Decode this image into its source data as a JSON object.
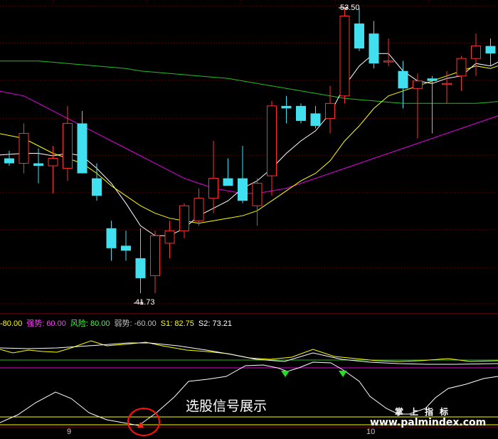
{
  "chart": {
    "high_marker": "53.50",
    "low_marker": "41.73",
    "legend": [
      {
        "text": "-80.00",
        "color": "#ffff00"
      },
      {
        "text": "强势: 60.00",
        "color": "#ff40ff"
      },
      {
        "text": "风险: 80.00",
        "color": "#40ff40"
      },
      {
        "text": "弱势: -60.00",
        "color": "#c0c0c0"
      },
      {
        "text": "S1: 82.75",
        "color": "#ffff00"
      },
      {
        "text": "S2: 73.21",
        "color": "#ffffff"
      }
    ],
    "signal_caption": "选股信号展示",
    "watermark_zh": "掌上指标",
    "watermark_url": "www.palmindex.com",
    "date_labels": [
      "9",
      "10"
    ]
  },
  "colors": {
    "background": "#000000",
    "up_candle": "#ff3030",
    "down_candle": "#40e0f0",
    "ma_short": "#ffffff",
    "ma_mid": "#ffff00",
    "ma_long": "#e000e0",
    "ma_longest": "#20c020"
  },
  "chart_data": {
    "type": "candlestick",
    "ylim": [
      41.73,
      53.5
    ],
    "candles": [
      {
        "open": 47.5,
        "high": 47.8,
        "low": 47.2,
        "close": 47.3
      },
      {
        "open": 47.3,
        "high": 48.9,
        "low": 46.9,
        "close": 48.5
      },
      {
        "open": 47.3,
        "high": 47.9,
        "low": 46.5,
        "close": 47.2
      },
      {
        "open": 47.2,
        "high": 48.0,
        "low": 46.1,
        "close": 47.5
      },
      {
        "open": 47.1,
        "high": 49.6,
        "low": 46.6,
        "close": 48.9
      },
      {
        "open": 48.9,
        "high": 49.4,
        "low": 47.0,
        "close": 46.9
      },
      {
        "open": 46.7,
        "high": 47.3,
        "low": 45.8,
        "close": 46.0
      },
      {
        "open": 44.7,
        "high": 45.0,
        "low": 43.4,
        "close": 43.9
      },
      {
        "open": 44.0,
        "high": 44.6,
        "low": 43.4,
        "close": 43.8
      },
      {
        "open": 43.5,
        "high": 44.7,
        "low": 42.1,
        "close": 42.7
      },
      {
        "open": 42.8,
        "high": 44.6,
        "low": 42.1,
        "close": 44.4
      },
      {
        "open": 44.1,
        "high": 45.0,
        "low": 43.5,
        "close": 44.6
      },
      {
        "open": 44.6,
        "high": 45.7,
        "low": 44.3,
        "close": 45.6
      },
      {
        "open": 45.0,
        "high": 46.3,
        "low": 44.8,
        "close": 45.9
      },
      {
        "open": 45.9,
        "high": 48.2,
        "low": 45.3,
        "close": 46.7
      },
      {
        "open": 46.7,
        "high": 47.5,
        "low": 46.4,
        "close": 46.4
      },
      {
        "open": 46.7,
        "high": 48.0,
        "low": 45.7,
        "close": 45.8
      },
      {
        "open": 45.6,
        "high": 46.7,
        "low": 44.8,
        "close": 46.5
      },
      {
        "open": 46.8,
        "high": 49.8,
        "low": 46.0,
        "close": 49.6
      },
      {
        "open": 49.6,
        "high": 50.0,
        "low": 48.9,
        "close": 49.5
      },
      {
        "open": 49.6,
        "high": 49.7,
        "low": 48.9,
        "close": 49.0
      },
      {
        "open": 49.3,
        "high": 49.6,
        "low": 48.7,
        "close": 48.8
      },
      {
        "open": 49.1,
        "high": 50.4,
        "low": 48.5,
        "close": 49.7
      },
      {
        "open": 50.0,
        "high": 53.5,
        "low": 49.7,
        "close": 53.2
      },
      {
        "open": 52.9,
        "high": 53.5,
        "low": 51.8,
        "close": 51.9
      },
      {
        "open": 52.5,
        "high": 53.0,
        "low": 51.1,
        "close": 51.3
      },
      {
        "open": 51.4,
        "high": 52.3,
        "low": 51.2,
        "close": 51.4
      },
      {
        "open": 51.0,
        "high": 51.4,
        "low": 49.5,
        "close": 50.3
      },
      {
        "open": 50.3,
        "high": 50.9,
        "low": 48.3,
        "close": 50.6
      },
      {
        "open": 50.7,
        "high": 50.8,
        "low": 48.5,
        "close": 50.6
      },
      {
        "open": 50.5,
        "high": 51.0,
        "low": 49.7,
        "close": 50.5
      },
      {
        "open": 50.8,
        "high": 51.6,
        "low": 50.2,
        "close": 51.5
      },
      {
        "open": 51.5,
        "high": 52.5,
        "low": 50.8,
        "close": 52.0
      },
      {
        "open": 52.0,
        "high": 52.3,
        "low": 51.2,
        "close": 51.7
      },
      {
        "open": 51.6,
        "high": 51.8,
        "low": 50.6,
        "close": 51.6
      },
      {
        "open": 51.2,
        "high": 52.6,
        "low": 51.0,
        "close": 52.2
      }
    ],
    "ma_short": [
      47.6,
      47.7,
      47.7,
      47.6,
      47.7,
      47.6,
      47.1,
      46.5,
      45.7,
      44.8,
      44.4,
      44.4,
      44.7,
      45.2,
      45.5,
      45.8,
      46.3,
      46.6,
      47.1,
      47.7,
      48.2,
      48.6,
      49.3,
      50.4,
      51.2,
      51.7,
      51.7,
      51.0,
      50.6,
      50.5,
      50.7,
      50.8,
      51.3,
      51.2,
      51.5,
      51.6
    ],
    "ma_mid": [
      48.6,
      48.3,
      48.0,
      47.7,
      47.5,
      47.3,
      46.9,
      46.4,
      46.0,
      45.6,
      45.3,
      45.1,
      45.0,
      44.9,
      45.0,
      45.1,
      45.2,
      45.4,
      45.8,
      46.2,
      46.6,
      46.9,
      47.4,
      48.2,
      48.8,
      49.5,
      50.0,
      50.2,
      50.4,
      50.6,
      50.8,
      51.0,
      51.2,
      51.1,
      51.3,
      51.3
    ],
    "ma_long": [
      50.3,
      50.0,
      49.7,
      49.4,
      49.1,
      48.8,
      48.5,
      48.2,
      47.9,
      47.6,
      47.3,
      47.0,
      46.7,
      46.5,
      46.3,
      46.2,
      46.1,
      46.1,
      46.2,
      46.3,
      46.5,
      46.7,
      46.9,
      47.1,
      47.3,
      47.5,
      47.7,
      47.9,
      48.1,
      48.3,
      48.5,
      48.7,
      48.9,
      49.1,
      49.3,
      49.5
    ],
    "ma_longest": [
      51.4,
      51.4,
      51.4,
      51.35,
      51.3,
      51.25,
      51.2,
      51.15,
      51.1,
      51.0,
      50.95,
      50.9,
      50.85,
      50.8,
      50.75,
      50.7,
      50.6,
      50.5,
      50.4,
      50.3,
      50.2,
      50.1,
      50.0,
      49.9,
      49.85,
      49.8,
      49.75,
      49.7,
      49.7,
      49.7,
      49.7,
      49.7,
      49.7,
      49.75,
      49.8,
      49.85
    ],
    "indicator": {
      "levels": {
        "强势": 60.0,
        "风险": 80.0,
        "弱势": -60.0
      },
      "S1": 82.75,
      "S2": 73.21
    }
  }
}
